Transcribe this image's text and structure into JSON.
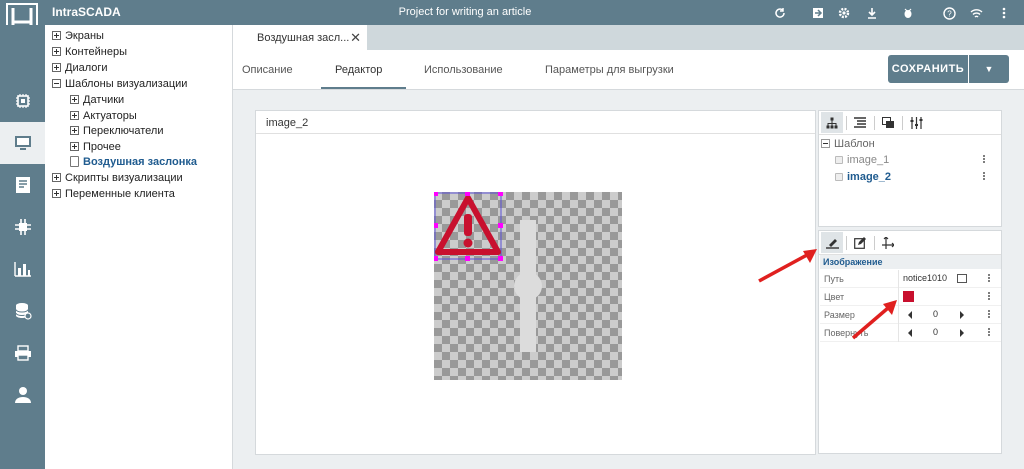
{
  "app": {
    "title": "IntraSCADA",
    "project": "Project for writing an article"
  },
  "topbar": {
    "icons": [
      "refresh-icon",
      "log-icon",
      "gear-icon",
      "download-icon",
      "bug-icon",
      "help-icon",
      "wifi-icon",
      "more-vert-icon"
    ]
  },
  "rail": {
    "items": [
      "devices-icon",
      "screens-icon",
      "reports-icon",
      "network-icon",
      "charts-icon",
      "database-icon",
      "printer-icon",
      "user-icon"
    ],
    "active_index": 1
  },
  "tree": {
    "items": [
      {
        "label": "Экраны",
        "level": 0,
        "kind": "plus"
      },
      {
        "label": "Контейнеры",
        "level": 0,
        "kind": "plus"
      },
      {
        "label": "Диалоги",
        "level": 0,
        "kind": "plus"
      },
      {
        "label": "Шаблоны визуализации",
        "level": 0,
        "kind": "minus"
      },
      {
        "label": "Датчики",
        "level": 1,
        "kind": "plus"
      },
      {
        "label": "Актуаторы",
        "level": 1,
        "kind": "plus"
      },
      {
        "label": "Переключатели",
        "level": 1,
        "kind": "plus"
      },
      {
        "label": "Прочее",
        "level": 1,
        "kind": "plus"
      },
      {
        "label": "Воздушная заслонка",
        "level": 1,
        "kind": "doc",
        "selected": true
      },
      {
        "label": "Скрипты визуализации",
        "level": 0,
        "kind": "plus"
      },
      {
        "label": "Переменные клиента",
        "level": 0,
        "kind": "plus"
      }
    ]
  },
  "doc_tab": {
    "label": "Воздушная засл...",
    "close": "✕"
  },
  "subtabs": [
    "Описание",
    "Редактор",
    "Использование",
    "Параметры для выгрузки"
  ],
  "active_subtab": 1,
  "save": {
    "label": "СОХРАНИТЬ"
  },
  "editor": {
    "title": "image_2"
  },
  "structure": {
    "tabs": [
      "hierarchy-icon",
      "list-icon",
      "layers-icon",
      "tune-icon"
    ],
    "root": "Шаблон",
    "items": [
      {
        "label": "image_1",
        "selected": false
      },
      {
        "label": "image_2",
        "selected": true
      }
    ]
  },
  "props": {
    "tabs": [
      "brush-icon",
      "edit-icon",
      "move-icon"
    ],
    "section": "Изображение",
    "rows": {
      "path": {
        "label": "Путь",
        "value": "notice1010"
      },
      "color": {
        "label": "Цвет",
        "value": "#c8102e"
      },
      "size": {
        "label": "Размер",
        "value": "0"
      },
      "rotate": {
        "label": "Повернуть",
        "value": "0"
      }
    }
  },
  "colors": {
    "accent": "#5f7d8c",
    "selection": "#ff00ff",
    "warning": "#c8102e",
    "arrow": "#e0201f"
  }
}
